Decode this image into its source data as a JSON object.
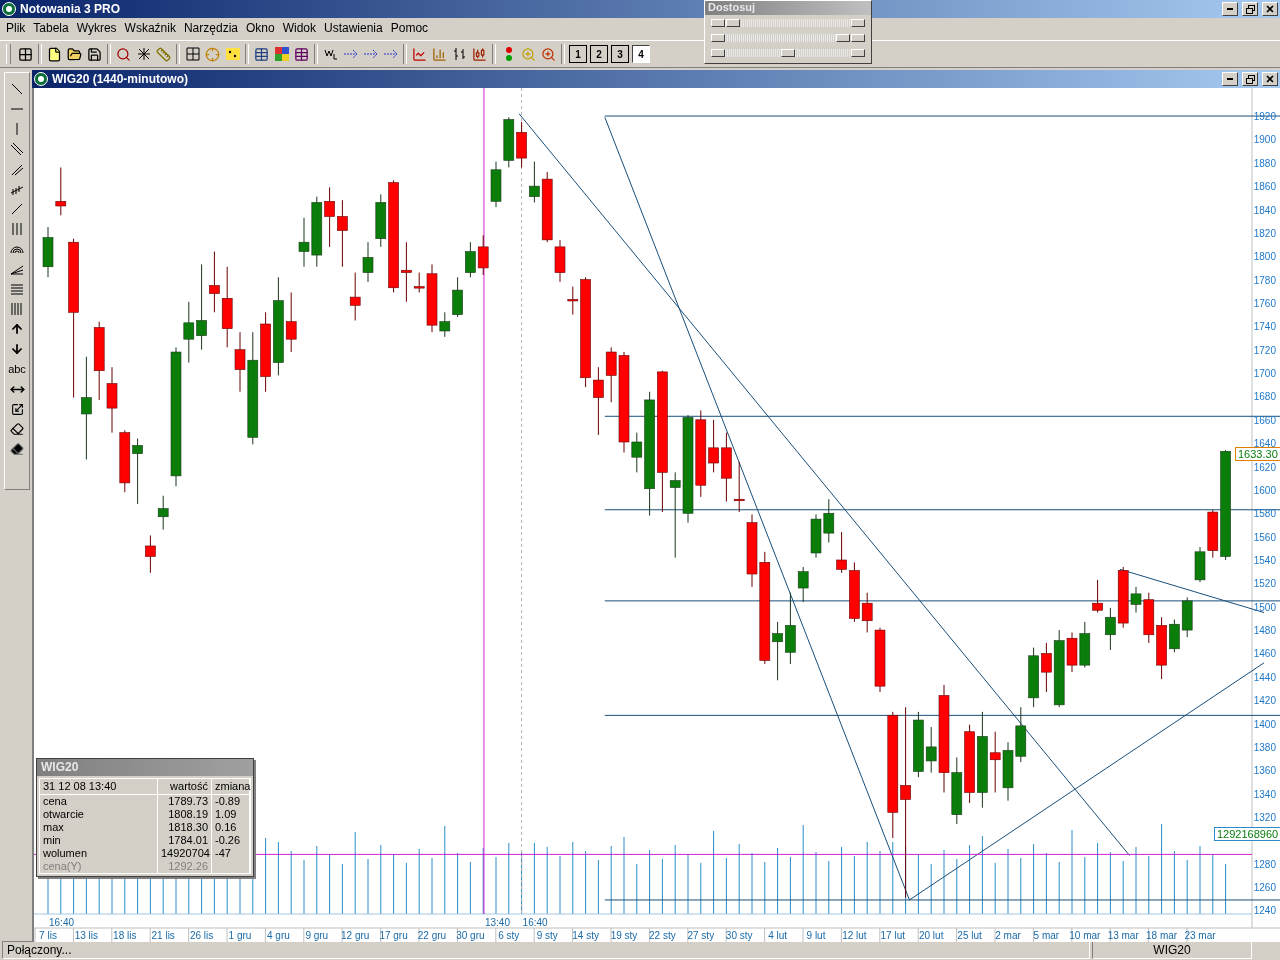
{
  "window": {
    "title": "Notowania 3 PRO"
  },
  "menu": [
    "Plik",
    "Tabela",
    "Wykres",
    "Wskaźnik",
    "Narzędzia",
    "Okno",
    "Widok",
    "Ustawienia",
    "Pomoc"
  ],
  "layout_buttons": [
    {
      "label": "1",
      "selected": false
    },
    {
      "label": "2",
      "selected": false
    },
    {
      "label": "3",
      "selected": false
    },
    {
      "label": "4",
      "selected": true
    }
  ],
  "adjust_panel": {
    "title": "Dostosuj",
    "sliders": [
      {
        "level": 0.06
      },
      {
        "level": 0.94
      },
      {
        "level": 0.5
      }
    ]
  },
  "drawing_tools": {
    "text_tool": "abc"
  },
  "chart_window": {
    "title": "WIG20 (1440-minutowo)",
    "price_marker": "1633.30",
    "volume_marker": "1292168960",
    "time_labels": [
      "16:40",
      "13:40",
      "16:40"
    ],
    "chart_data": {
      "type": "candlestick",
      "ylim": [
        1225,
        1944
      ],
      "yticks": [
        1240,
        1260,
        1280,
        1320,
        1340,
        1360,
        1380,
        1400,
        1420,
        1440,
        1460,
        1480,
        1500,
        1520,
        1540,
        1560,
        1580,
        1600,
        1620,
        1640,
        1660,
        1680,
        1700,
        1720,
        1740,
        1760,
        1780,
        1800,
        1820,
        1840,
        1860,
        1880,
        1900,
        1920
      ],
      "categories": [
        "7 lis",
        null,
        null,
        "13 lis",
        null,
        null,
        "18 lis",
        null,
        null,
        "21 lis",
        null,
        null,
        "26 lis",
        null,
        null,
        "1 gru",
        null,
        null,
        "4 gru",
        null,
        null,
        "9 gru",
        null,
        null,
        "12 gru",
        null,
        null,
        "17 gru",
        null,
        null,
        "22 gru",
        null,
        null,
        "30 gru",
        null,
        null,
        "6 sty",
        null,
        null,
        "9 sty",
        null,
        null,
        "14 sty",
        null,
        null,
        "19 sty",
        null,
        null,
        "22 sty",
        null,
        null,
        "27 sty",
        null,
        null,
        "30 sty",
        null,
        null,
        "4 lut",
        null,
        null,
        "9 lut",
        null,
        null,
        "12 lut",
        null,
        null,
        "17 lut",
        null,
        null,
        "20 lut",
        null,
        null,
        "25 lut",
        null,
        null,
        "2 mar",
        null,
        null,
        "5 mar",
        null,
        null,
        "10 mar",
        null,
        null,
        "13 mar",
        null,
        null,
        "18 mar",
        null,
        null,
        "23 mar",
        null,
        null
      ],
      "ohlc": [
        [
          1791,
          1825,
          1782,
          1816
        ],
        [
          1847,
          1876,
          1835,
          1843
        ],
        [
          1812,
          1815,
          1679,
          1752
        ],
        [
          1665,
          1714,
          1626,
          1679
        ],
        [
          1739,
          1744,
          1677,
          1702
        ],
        [
          1691,
          1705,
          1649,
          1670
        ],
        [
          1649,
          1651,
          1598,
          1606
        ],
        [
          1631,
          1644,
          1588,
          1638
        ],
        [
          1552,
          1561,
          1529,
          1543
        ],
        [
          1577,
          1595,
          1566,
          1584
        ],
        [
          1612,
          1722,
          1603,
          1718
        ],
        [
          1729,
          1761,
          1709,
          1743
        ],
        [
          1732,
          1793,
          1720,
          1745
        ],
        [
          1775,
          1804,
          1752,
          1768
        ],
        [
          1764,
          1791,
          1722,
          1738
        ],
        [
          1720,
          1735,
          1684,
          1703
        ],
        [
          1645,
          1735,
          1639,
          1711
        ],
        [
          1742,
          1752,
          1684,
          1697
        ],
        [
          1709,
          1782,
          1698,
          1762
        ],
        [
          1744,
          1769,
          1718,
          1729
        ],
        [
          1804,
          1833,
          1791,
          1812
        ],
        [
          1801,
          1851,
          1791,
          1846
        ],
        [
          1847,
          1859,
          1808,
          1834
        ],
        [
          1834,
          1848,
          1791,
          1822
        ],
        [
          1765,
          1786,
          1745,
          1758
        ],
        [
          1786,
          1812,
          1778,
          1799
        ],
        [
          1815,
          1853,
          1808,
          1846
        ],
        [
          1863,
          1865,
          1769,
          1773
        ],
        [
          1788,
          1812,
          1761,
          1786
        ],
        [
          1774,
          1786,
          1769,
          1773
        ],
        [
          1785,
          1793,
          1735,
          1741
        ],
        [
          1736,
          1752,
          1731,
          1744
        ],
        [
          1750,
          1782,
          1748,
          1771
        ],
        [
          1786,
          1812,
          1782,
          1804
        ],
        [
          1808,
          1818,
          1784,
          1790
        ],
        [
          1847,
          1881,
          1842,
          1874
        ],
        [
          1882,
          1919,
          1876,
          1917
        ],
        [
          1906,
          1915,
          1876,
          1884
        ],
        [
          1851,
          1881,
          1846,
          1860
        ],
        [
          1866,
          1872,
          1812,
          1814
        ],
        [
          1808,
          1814,
          1778,
          1786
        ],
        [
          1763,
          1774,
          1750,
          1762
        ],
        [
          1780,
          1782,
          1688,
          1696
        ],
        [
          1694,
          1705,
          1647,
          1679
        ],
        [
          1718,
          1722,
          1675,
          1698
        ],
        [
          1715,
          1718,
          1632,
          1641
        ],
        [
          1628,
          1649,
          1615,
          1641
        ],
        [
          1601,
          1684,
          1578,
          1677
        ],
        [
          1701,
          1702,
          1581,
          1615
        ],
        [
          1602,
          1615,
          1542,
          1608
        ],
        [
          1580,
          1664,
          1572,
          1662
        ],
        [
          1660,
          1668,
          1594,
          1604
        ],
        [
          1636,
          1660,
          1615,
          1623
        ],
        [
          1636,
          1649,
          1590,
          1610
        ],
        [
          1592,
          1624,
          1581,
          1591
        ],
        [
          1572,
          1579,
          1517,
          1528
        ],
        [
          1538,
          1547,
          1451,
          1454
        ],
        [
          1470,
          1487,
          1437,
          1477
        ],
        [
          1461,
          1512,
          1451,
          1484
        ],
        [
          1516,
          1534,
          1504,
          1530
        ],
        [
          1546,
          1579,
          1542,
          1575
        ],
        [
          1563,
          1592,
          1555,
          1580
        ],
        [
          1540,
          1564,
          1529,
          1532
        ],
        [
          1531,
          1538,
          1487,
          1490
        ],
        [
          1503,
          1512,
          1478,
          1488
        ],
        [
          1480,
          1482,
          1427,
          1432
        ],
        [
          1407,
          1410,
          1302,
          1324
        ],
        [
          1347,
          1414,
          1251,
          1335
        ],
        [
          1359,
          1410,
          1354,
          1403
        ],
        [
          1368,
          1397,
          1358,
          1380
        ],
        [
          1424,
          1433,
          1341,
          1358
        ],
        [
          1322,
          1371,
          1314,
          1358
        ],
        [
          1393,
          1399,
          1332,
          1341
        ],
        [
          1341,
          1410,
          1328,
          1389
        ],
        [
          1375,
          1393,
          1341,
          1369
        ],
        [
          1345,
          1384,
          1334,
          1377
        ],
        [
          1372,
          1414,
          1367,
          1398
        ],
        [
          1422,
          1465,
          1414,
          1458
        ],
        [
          1460,
          1469,
          1427,
          1444
        ],
        [
          1416,
          1480,
          1414,
          1471
        ],
        [
          1473,
          1478,
          1444,
          1450
        ],
        [
          1450,
          1487,
          1448,
          1477
        ],
        [
          1503,
          1523,
          1495,
          1497
        ],
        [
          1476,
          1499,
          1463,
          1491
        ],
        [
          1531,
          1534,
          1482,
          1486
        ],
        [
          1502,
          1517,
          1495,
          1511
        ],
        [
          1506,
          1512,
          1469,
          1476
        ],
        [
          1484,
          1491,
          1438,
          1450
        ],
        [
          1464,
          1489,
          1461,
          1485
        ],
        [
          1480,
          1508,
          1474,
          1505
        ],
        [
          1523,
          1551,
          1521,
          1547
        ],
        [
          1581,
          1583,
          1542,
          1548
        ],
        [
          1543,
          1634,
          1540,
          1633
        ]
      ]
    },
    "info_panel": {
      "title": "WIG20",
      "timestamp": "31 12 08 13:40",
      "columns": [
        "wartość",
        "zmiana"
      ],
      "rows": [
        {
          "label": "cena",
          "value": "1789.73",
          "change": "-0.89",
          "disabled": false
        },
        {
          "label": "otwarcie",
          "value": "1808.19",
          "change": "1.09",
          "disabled": false
        },
        {
          "label": "max",
          "value": "1818.30",
          "change": "0.16",
          "disabled": false
        },
        {
          "label": "min",
          "value": "1784.01",
          "change": "-0.26",
          "disabled": false
        },
        {
          "label": "wolumen",
          "value": "14920704",
          "change": "-47",
          "disabled": false
        },
        {
          "label": "cena(Y)",
          "value": "1292.26",
          "disabled": true
        }
      ]
    }
  },
  "status_bar": {
    "message": "Połączony...",
    "instrument": "WIG20"
  }
}
